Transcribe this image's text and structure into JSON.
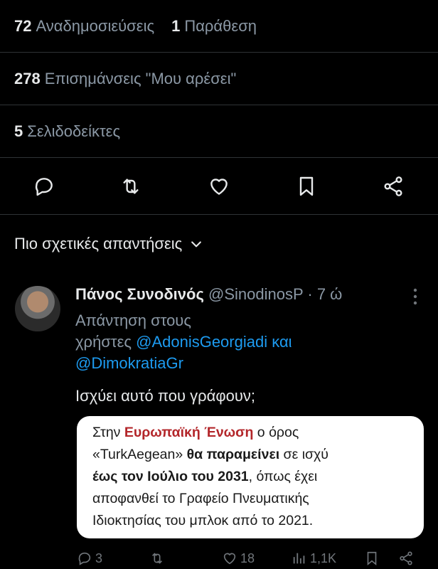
{
  "stats": {
    "reposts_count": "72",
    "reposts_label": "Αναδημοσιεύσεις",
    "quotes_count": "1",
    "quotes_label": "Παράθεση",
    "likes_count": "278",
    "likes_label": "Επισημάνσεις \"Μου αρέσει\"",
    "bookmarks_count": "5",
    "bookmarks_label": "Σελιδοδείκτες"
  },
  "actions": [
    "reply-icon",
    "repost-icon",
    "like-icon",
    "bookmark-icon",
    "share-icon"
  ],
  "sort_label": "Πιο σχετικές απαντήσεις",
  "reply": {
    "author_name": "Πάνος Συνοδινός",
    "author_handle": "@SinodinosP",
    "time": "· 7 ώ",
    "reply_prefix_1": "Απάντηση στους",
    "reply_prefix_2": "χρήστες",
    "mention_1": "@AdonisGeorgiadi",
    "conj": "και",
    "mention_2": "@DimokratiaGr",
    "text": "Ισχύει αυτό που γράφουν;",
    "image_text": {
      "l1a": "Στην ",
      "l1b": "Ευρωπαϊκή Ένωση",
      "l1c": " ο όρος",
      "l2a": "«TurkAegean» ",
      "l2b": "θα παραμείνει",
      "l2c": " σε ισχύ",
      "l3a": "έως τον Ιούλιο του 2031",
      "l3b": ", όπως έχει",
      "l4": "αποφανθεί το Γραφείο Πνευματικής",
      "l5": "Ιδιοκτησίας του μπλοκ από το 2021."
    },
    "metrics": {
      "replies": "3",
      "reposts": "",
      "likes": "18",
      "views": "1,1K"
    }
  }
}
